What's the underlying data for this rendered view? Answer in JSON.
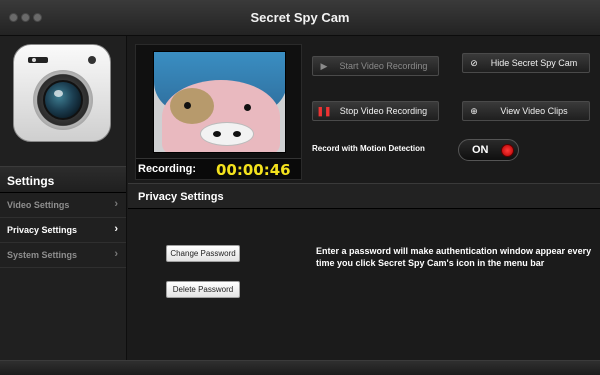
{
  "window": {
    "title": "Secret Spy Cam"
  },
  "sidebar": {
    "app_icon": "camera-app-icon",
    "heading": "Settings",
    "items": [
      {
        "label": "Video Settings",
        "active": false
      },
      {
        "label": "Privacy Settings",
        "active": true
      },
      {
        "label": "System Settings",
        "active": false
      }
    ],
    "chevron": "›"
  },
  "camera": {
    "recording_label": "Recording:",
    "recording_time": "00:00:46"
  },
  "controls": {
    "start_label": "Start Video Recording",
    "start_icon": "▶",
    "stop_label": "Stop Video  Recording",
    "stop_icon": "❚❚",
    "hide_label": "Hide Secret Spy Cam",
    "hide_icon": "⊘",
    "clips_label": "View Video Clips",
    "clips_icon": "⊕",
    "motion_label": "Record with Motion Detection",
    "toggle_state": "ON"
  },
  "privacy": {
    "heading": "Privacy Settings",
    "change_password": "Change Password",
    "delete_password": "Delete Password",
    "info": "Enter a password will make authentication window appear every time you click Secret Spy Cam's icon in the menu bar"
  },
  "colors": {
    "timer": "#f4e21d",
    "toggle_knob": "#ff3b3b"
  }
}
